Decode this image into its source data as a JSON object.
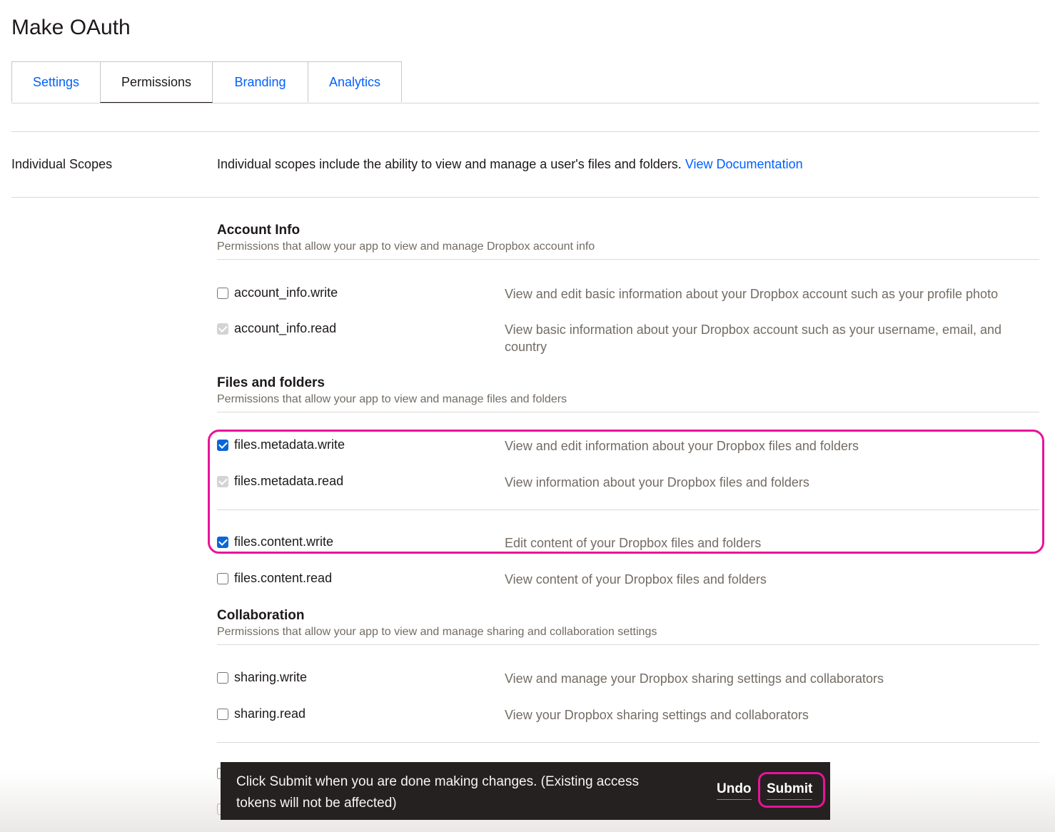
{
  "page": {
    "title": "Make OAuth"
  },
  "tabs": [
    {
      "label": "Settings",
      "active": false
    },
    {
      "label": "Permissions",
      "active": true
    },
    {
      "label": "Branding",
      "active": false
    },
    {
      "label": "Analytics",
      "active": false
    }
  ],
  "individual_scopes": {
    "label": "Individual Scopes",
    "description": "Individual scopes include the ability to view and manage a user's files and folders.",
    "link_text": "View Documentation"
  },
  "sections": [
    {
      "title": "Account Info",
      "subtitle": "Permissions that allow your app to view and manage Dropbox account info",
      "scopes": [
        {
          "name": "account_info.write",
          "description": "View and edit basic information about your Dropbox account such as your profile photo",
          "state": "unchecked"
        },
        {
          "name": "account_info.read",
          "description": "View basic information about your Dropbox account such as your username, email, and country",
          "state": "disabled-checked"
        }
      ]
    },
    {
      "title": "Files and folders",
      "subtitle": "Permissions that allow your app to view and manage files and folders",
      "scopes": [
        {
          "name": "files.metadata.write",
          "description": "View and edit information about your Dropbox files and folders",
          "state": "checked"
        },
        {
          "name": "files.metadata.read",
          "description": "View information about your Dropbox files and folders",
          "state": "disabled-checked"
        },
        {
          "name": "files.content.write",
          "description": "Edit content of your Dropbox files and folders",
          "state": "checked"
        },
        {
          "name": "files.content.read",
          "description": "View content of your Dropbox files and folders",
          "state": "unchecked"
        }
      ]
    },
    {
      "title": "Collaboration",
      "subtitle": "Permissions that allow your app to view and manage sharing and collaboration settings",
      "scopes": [
        {
          "name": "sharing.write",
          "description": "View and manage your Dropbox sharing settings and collaborators",
          "state": "unchecked"
        },
        {
          "name": "sharing.read",
          "description": "View your Dropbox sharing settings and collaborators",
          "state": "unchecked"
        }
      ]
    }
  ],
  "toast": {
    "message": "Click Submit when you are done making changes. (Existing access tokens will not be affected)",
    "undo_label": "Undo",
    "submit_label": "Submit"
  },
  "colors": {
    "link": "#0061fe",
    "highlight": "#e8139a",
    "checkbox_checked": "#0a66d8",
    "toast_bg": "#242120"
  }
}
